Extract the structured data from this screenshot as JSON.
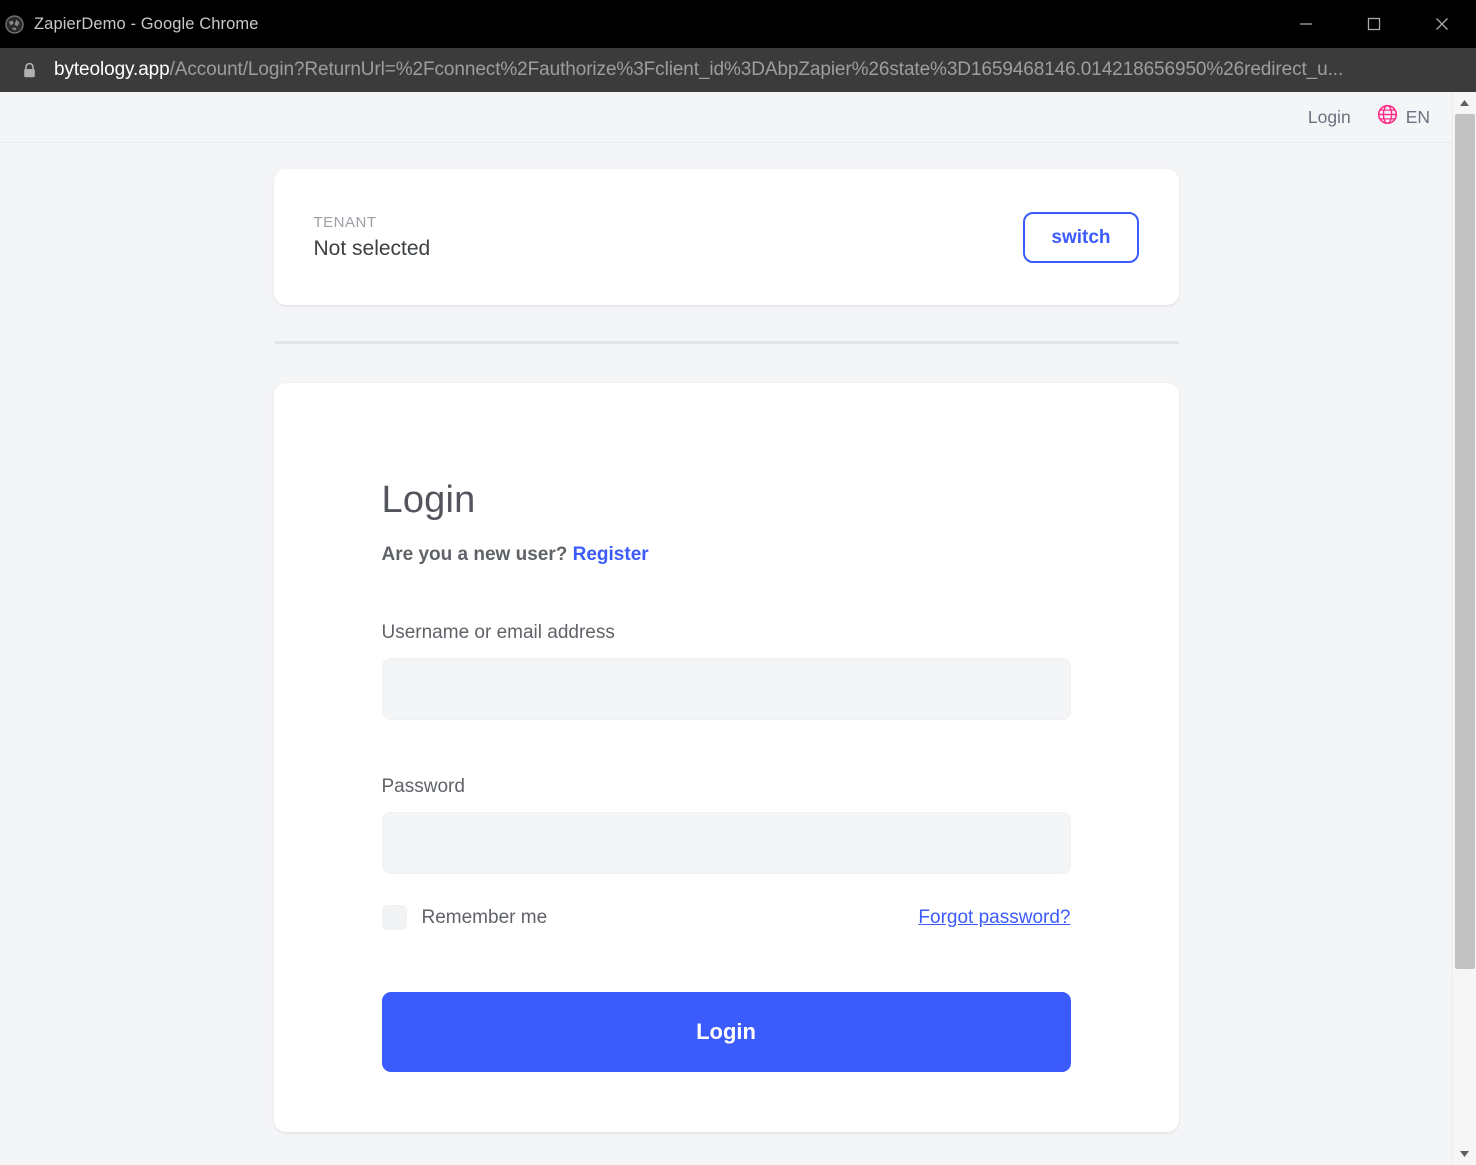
{
  "browser": {
    "window_title": "ZapierDemo - Google Chrome",
    "favicon": "globe-favicon",
    "lock_icon": "lock-icon",
    "url_domain": "byteology.app",
    "url_rest": "/Account/Login?ReturnUrl=%2Fconnect%2Fauthorize%3Fclient_id%3DAbpZapier%26state%3D1659468146.014218656950%26redirect_u...",
    "controls": {
      "minimize": "minimize-icon",
      "maximize": "maximize-icon",
      "close": "close-icon"
    }
  },
  "topnav": {
    "login_label": "Login",
    "language_label": "EN",
    "language_icon": "globe-icon"
  },
  "tenant": {
    "label": "TENANT",
    "value": "Not selected",
    "switch_label": "switch"
  },
  "login": {
    "title": "Login",
    "new_user_text": "Are you a new user?",
    "register_label": "Register",
    "username_label": "Username or email address",
    "username_value": "",
    "username_placeholder": "",
    "password_label": "Password",
    "password_value": "",
    "password_placeholder": "",
    "remember_label": "Remember me",
    "remember_checked": false,
    "forgot_label": "Forgot password?",
    "submit_label": "Login"
  },
  "colors": {
    "accent": "#3b5bfd",
    "page_bg": "#f4f5f7",
    "card_bg": "#ffffff",
    "text_muted": "#6b7280",
    "globe_pink": "#ff2d87"
  }
}
